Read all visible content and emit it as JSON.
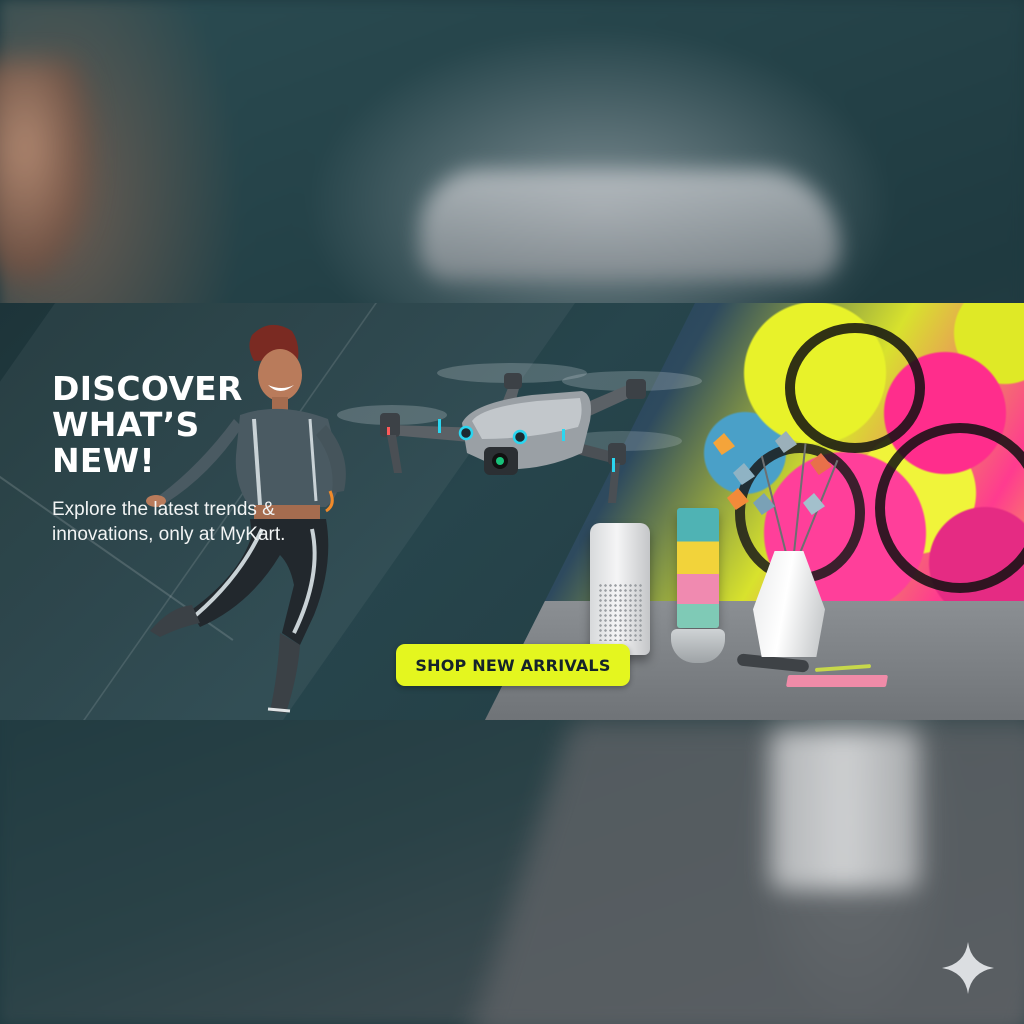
{
  "banner": {
    "headline_lines": [
      "DISCOVER",
      "WHAT’S",
      "NEW!"
    ],
    "subtext_lines": [
      "Explore the latest trends &",
      "innovations, only at MyKart."
    ],
    "cta_label": "SHOP NEW ARRIVALS"
  },
  "colors": {
    "banner_bg": "#1f3a40",
    "cta_bg": "#e4f61f",
    "cta_text": "#15232a",
    "graffiti_pink": "#ff2d8c",
    "graffiti_yellow": "#e8f22a",
    "text": "#ffffff"
  },
  "icons": {
    "watermark": "sparkle-icon",
    "drone": "drone-illustration",
    "person": "jumping-person-illustration"
  }
}
